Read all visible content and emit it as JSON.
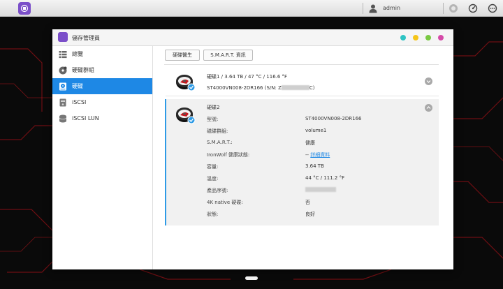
{
  "taskbar": {
    "username": "admin"
  },
  "window": {
    "title": "儲存管理員",
    "controls": [
      {
        "name": "help",
        "color": "#2ec4c4"
      },
      {
        "name": "minimize",
        "color": "#f5c518"
      },
      {
        "name": "maximize",
        "color": "#7ac943"
      },
      {
        "name": "close",
        "color": "#d54aa8"
      }
    ]
  },
  "sidebar": {
    "items": [
      {
        "label": "總覽",
        "icon": "overview-icon"
      },
      {
        "label": "硬碟群組",
        "icon": "disk-group-icon"
      },
      {
        "label": "硬碟",
        "icon": "hard-disk-icon"
      },
      {
        "label": "iSCSI",
        "icon": "iscsi-icon"
      },
      {
        "label": "iSCSI LUN",
        "icon": "iscsi-lun-icon"
      }
    ],
    "active_index": 2
  },
  "toolbar": {
    "health_button": "硬碟醫生",
    "smart_button": "S.M.A.R.T. 資訊"
  },
  "disks": [
    {
      "title": "硬碟1 / 3.64 TB / 47 °C / 116.6 °F",
      "model_line_prefix": "ST4000VN008-2DR166 (S/N: Z",
      "model_line_suffix": "C)"
    },
    {
      "title": "硬碟2",
      "properties": [
        {
          "label": "型號:",
          "value": "ST4000VN008-2DR166"
        },
        {
          "label": "磁碟群組:",
          "value": "volume1"
        },
        {
          "label": "S.M.A.R.T.:",
          "value": "健康"
        },
        {
          "label": "IronWolf 健康狀態:",
          "value": "-- ",
          "link": "詳細資料"
        },
        {
          "label": "容量:",
          "value": "3.64 TB"
        },
        {
          "label": "溫度:",
          "value": "44 °C / 111.2 °F"
        },
        {
          "label": "產品序號:",
          "value": ""
        },
        {
          "label": "4K native 硬碟:",
          "value": "否"
        },
        {
          "label": "狀態:",
          "value": "良好"
        }
      ]
    }
  ],
  "colors": {
    "accent": "#1e88e5",
    "app_icon": "#7b4fc9",
    "check_badge": "#2e9be6"
  }
}
